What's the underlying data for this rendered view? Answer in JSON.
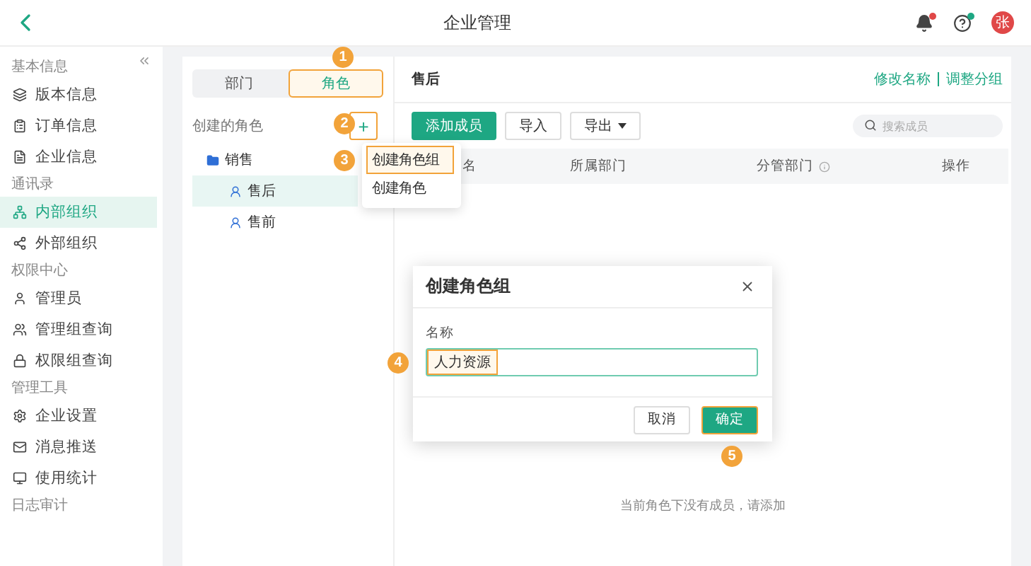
{
  "header": {
    "title": "企业管理",
    "avatar_text": "张"
  },
  "sidebar": {
    "sections": [
      {
        "title": "基本信息",
        "items": [
          {
            "label": "版本信息",
            "selected": false
          },
          {
            "label": "订单信息",
            "selected": false
          },
          {
            "label": "企业信息",
            "selected": false
          }
        ]
      },
      {
        "title": "通讯录",
        "items": [
          {
            "label": "内部组织",
            "selected": true
          },
          {
            "label": "外部组织",
            "selected": false
          }
        ]
      },
      {
        "title": "权限中心",
        "items": [
          {
            "label": "管理员",
            "selected": false
          },
          {
            "label": "管理组查询",
            "selected": false
          },
          {
            "label": "权限组查询",
            "selected": false
          }
        ]
      },
      {
        "title": "管理工具",
        "items": [
          {
            "label": "企业设置",
            "selected": false
          },
          {
            "label": "消息推送",
            "selected": false
          },
          {
            "label": "使用统计",
            "selected": false
          }
        ]
      },
      {
        "title": "日志审计"
      }
    ]
  },
  "left_pane": {
    "tabs": [
      {
        "label": "部门",
        "selected": false
      },
      {
        "label": "角色",
        "selected": true
      }
    ],
    "section_label": "创建的角色",
    "add_button": "+",
    "tree": [
      {
        "label": "销售",
        "selected": false,
        "expanded": true,
        "children": [
          {
            "label": "售后",
            "selected": true
          },
          {
            "label": "售前",
            "selected": false
          }
        ]
      }
    ]
  },
  "menu": {
    "items": [
      {
        "label": "创建角色组",
        "selected": true
      },
      {
        "label": "创建角色",
        "selected": false
      }
    ]
  },
  "right_pane": {
    "title": "售后",
    "links": [
      "修改名称",
      "调整分组"
    ],
    "toolbar": [
      {
        "label": "添加成员",
        "kind": "primary"
      },
      {
        "label": "导入",
        "kind": "plain"
      },
      {
        "label": "导出",
        "kind": "dropdown"
      }
    ],
    "search": {
      "placeholder": "搜索成员"
    },
    "columns": [
      {
        "label": "名",
        "info": false
      },
      {
        "label": "所属部门",
        "info": false
      },
      {
        "label": "分管部门",
        "info": true
      },
      {
        "label": "操作",
        "info": false
      }
    ],
    "empty_text": "当前角色下没有成员，请添加"
  },
  "dialog": {
    "title": "创建角色组",
    "field_label": "名称",
    "field_value": "人力资源",
    "buttons": [
      {
        "label": "取消",
        "kind": "plain"
      },
      {
        "label": "确定",
        "kind": "primary"
      }
    ]
  },
  "callouts": [
    "1",
    "2",
    "3",
    "4",
    "5"
  ]
}
